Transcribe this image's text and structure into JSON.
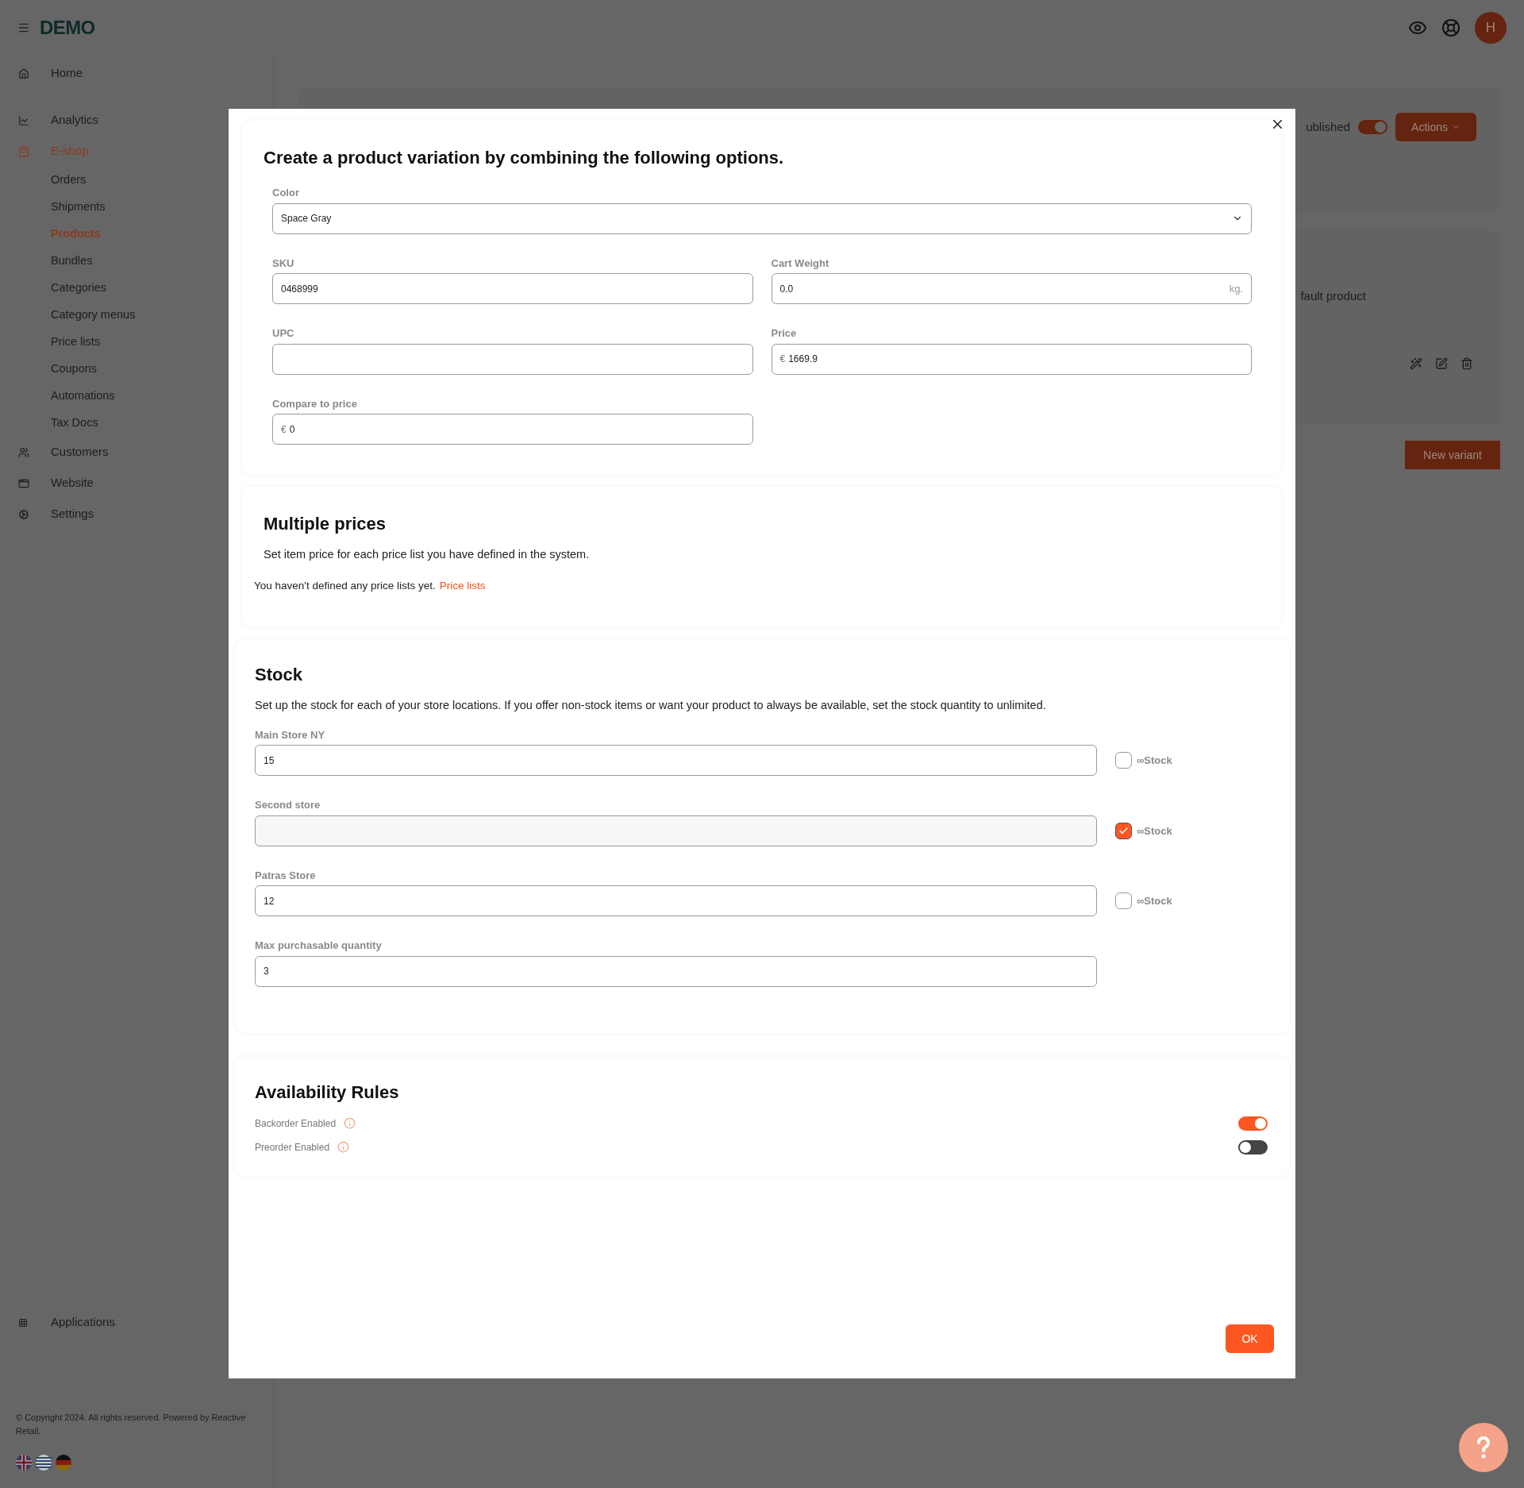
{
  "header": {
    "logo": "DEMO",
    "avatar": "H"
  },
  "sidebar": {
    "items": [
      {
        "label": "Home",
        "selected": false
      },
      {
        "label": "Analytics",
        "selected": false
      },
      {
        "label": "E-shop",
        "selected": true,
        "children": [
          {
            "label": "Orders",
            "selected": false
          },
          {
            "label": "Shipments",
            "selected": false
          },
          {
            "label": "Products",
            "selected": true
          },
          {
            "label": "Bundles",
            "selected": false
          },
          {
            "label": "Categories",
            "selected": false
          },
          {
            "label": "Category menus",
            "selected": false
          },
          {
            "label": "Price lists",
            "selected": false
          },
          {
            "label": "Coupons",
            "selected": false
          },
          {
            "label": "Automations",
            "selected": false
          },
          {
            "label": "Tax Docs",
            "selected": false
          }
        ]
      },
      {
        "label": "Customers",
        "selected": false
      },
      {
        "label": "Website",
        "selected": false
      },
      {
        "label": "Settings",
        "selected": false
      }
    ],
    "bottom_item": "Applications",
    "copyright": "© Copyright 2024. All rights reserved. Powered by Reactive Retail."
  },
  "background": {
    "published_label": "ublished",
    "published_on": true,
    "actions": "Actions",
    "product_text": "fault product",
    "new_variant": "New variant"
  },
  "modal": {
    "title": "Create a product variation by combining the following options.",
    "color": {
      "label": "Color",
      "value": "Space Gray"
    },
    "sku": {
      "label": "SKU",
      "value": "0468999"
    },
    "cart_weight": {
      "label": "Cart Weight",
      "value": "0.0",
      "unit": "kg."
    },
    "upc": {
      "label": "UPC"
    },
    "price": {
      "label": "Price",
      "currency": "€",
      "value": "1669.9"
    },
    "compare_price": {
      "label": "Compare to price",
      "currency": "€",
      "value": "0"
    },
    "multiple_prices": {
      "title": "Multiple prices",
      "description": "Set item price for each price list you have defined in the system.",
      "notice": "You haven't defined any price lists yet.",
      "link": "Price lists"
    },
    "stock": {
      "title": "Stock",
      "description": "Set up the stock for each of your store locations. If you offer non-stock items or want your product to always be available, set the stock quantity to unlimited.",
      "locations": [
        {
          "label": "Main Store NY",
          "value": "15",
          "unlimited": false,
          "unlimited_label": "∞Stock"
        },
        {
          "label": "Second store",
          "unlimited": true,
          "unlimited_label": "∞Stock"
        },
        {
          "label": "Patras Store",
          "value": "12",
          "unlimited": false,
          "unlimited_label": "∞Stock"
        }
      ],
      "max_quantity": {
        "label": "Max purchasable quantity",
        "value": "3"
      }
    },
    "availability": {
      "title": "Availability Rules",
      "rules": [
        {
          "label": "Backorder Enabled",
          "on": true
        },
        {
          "label": "Preorder Enabled",
          "on": false
        }
      ]
    },
    "ok": "OK"
  }
}
